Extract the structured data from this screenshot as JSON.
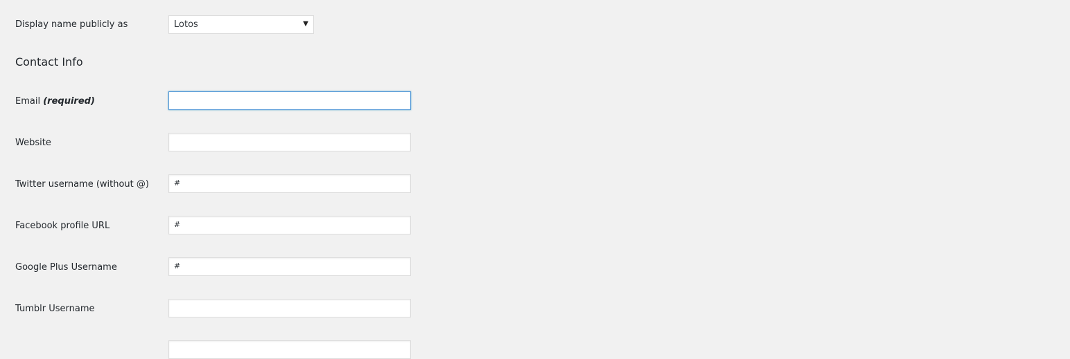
{
  "display_name": {
    "label": "Display name publicly as",
    "selected": "Lotos"
  },
  "contact_info": {
    "heading": "Contact Info",
    "email": {
      "label": "Email",
      "note": "(required)",
      "value": ""
    },
    "fields": [
      {
        "label": "Website",
        "value": ""
      },
      {
        "label": "Twitter username (without @)",
        "value": "#"
      },
      {
        "label": "Facebook profile URL",
        "value": "#"
      },
      {
        "label": "Google Plus Username",
        "value": "#"
      },
      {
        "label": "Tumblr Username",
        "value": ""
      },
      {
        "label": "",
        "value": ""
      }
    ]
  }
}
